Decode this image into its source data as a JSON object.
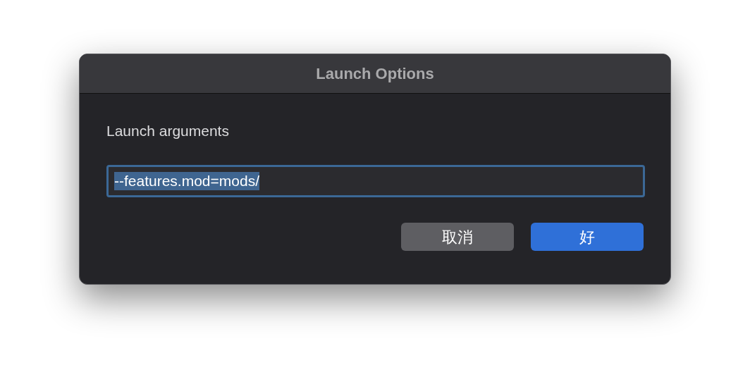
{
  "window": {
    "title": "Launch Options"
  },
  "label": "Launch arguments",
  "field": {
    "value": "--features.mod=mods/",
    "text_selected": true,
    "focused": true
  },
  "buttons": [
    {
      "label": "取消",
      "kind": "secondary"
    },
    {
      "label": "好",
      "kind": "primary"
    }
  ]
}
